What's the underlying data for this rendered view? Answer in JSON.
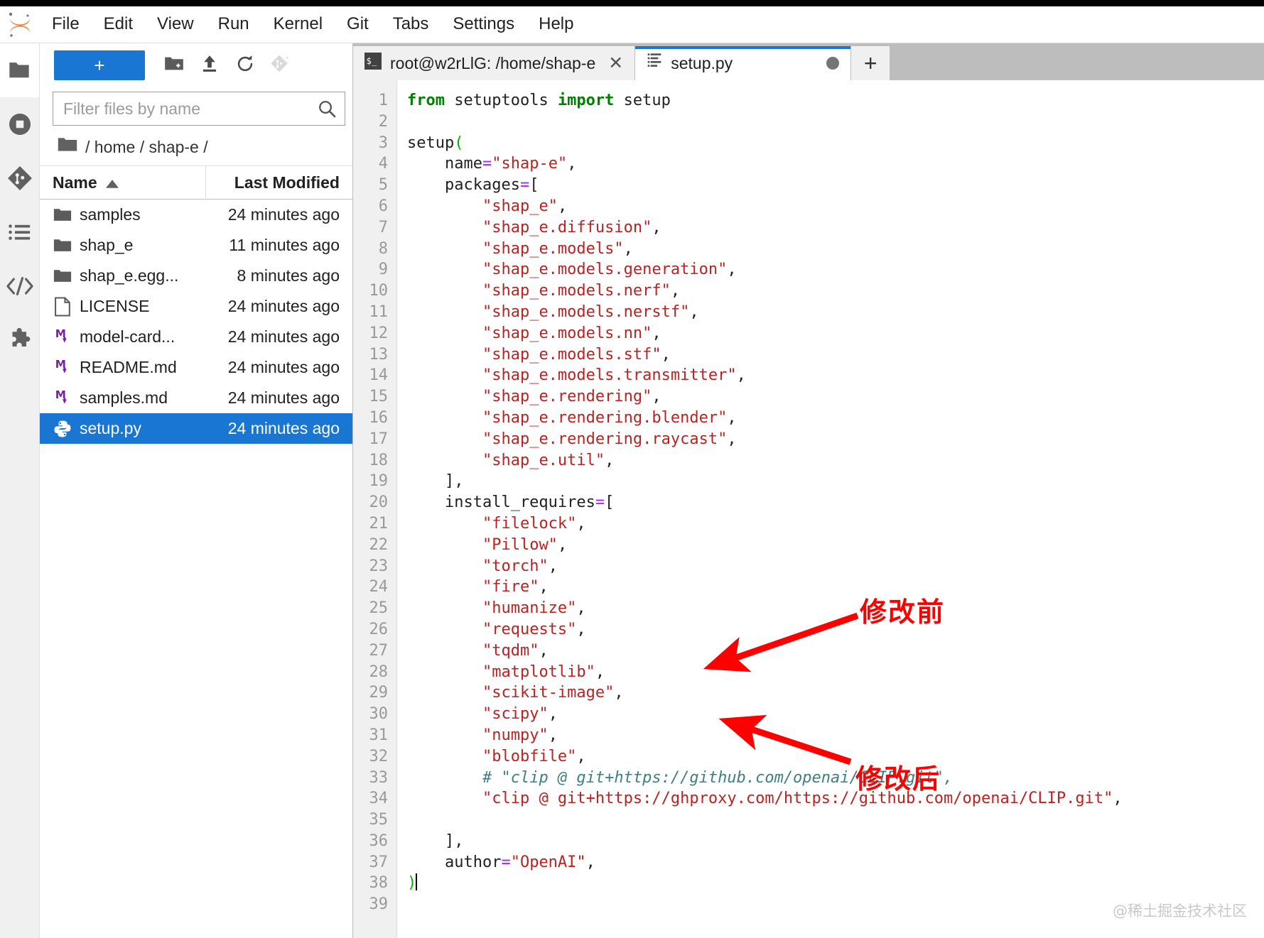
{
  "menubar": {
    "logo": "jupyter-logo",
    "items": [
      "File",
      "Edit",
      "View",
      "Run",
      "Kernel",
      "Git",
      "Tabs",
      "Settings",
      "Help"
    ]
  },
  "rail": {
    "items": [
      {
        "name": "file-browser",
        "icon": "folder-icon",
        "active": true
      },
      {
        "name": "running-terminals",
        "icon": "stop-circle-icon",
        "active": false
      },
      {
        "name": "git-panel",
        "icon": "git-icon",
        "active": false
      },
      {
        "name": "table-of-contents",
        "icon": "list-icon",
        "active": false
      },
      {
        "name": "code-snippets",
        "icon": "code-brackets-icon",
        "active": false
      },
      {
        "name": "extension-manager",
        "icon": "puzzle-piece-icon",
        "active": false
      }
    ]
  },
  "browser": {
    "toolbar": {
      "new_launcher_label": "+",
      "new_folder_icon": "new-folder-icon",
      "upload_icon": "upload-icon",
      "refresh_icon": "refresh-icon",
      "git_clone_icon": "git-clone-icon"
    },
    "filter": {
      "value": "",
      "placeholder": "Filter files by name",
      "search_icon": "search-icon"
    },
    "breadcrumb": "/ home / shap-e /",
    "columns": {
      "name": "Name",
      "last_modified": "Last Modified",
      "sort_indicator": "sort-ascending-icon"
    },
    "files": [
      {
        "name": "samples",
        "modified": "24 minutes ago",
        "icon": "folder-icon",
        "selected": false
      },
      {
        "name": "shap_e",
        "modified": "11 minutes ago",
        "icon": "folder-icon",
        "selected": false
      },
      {
        "name": "shap_e.egg...",
        "modified": "8 minutes ago",
        "icon": "folder-icon",
        "selected": false
      },
      {
        "name": "LICENSE",
        "modified": "24 minutes ago",
        "icon": "file-icon",
        "selected": false
      },
      {
        "name": "model-card...",
        "modified": "24 minutes ago",
        "icon": "markdown-icon",
        "selected": false
      },
      {
        "name": "README.md",
        "modified": "24 minutes ago",
        "icon": "markdown-icon",
        "selected": false
      },
      {
        "name": "samples.md",
        "modified": "24 minutes ago",
        "icon": "markdown-icon",
        "selected": false
      },
      {
        "name": "setup.py",
        "modified": "24 minutes ago",
        "icon": "python-icon",
        "selected": true
      }
    ]
  },
  "dock": {
    "tabs": [
      {
        "label": "root@w2rLlG: /home/shap-e",
        "icon": "terminal-icon",
        "active": false,
        "closable": true,
        "dirty": false
      },
      {
        "label": "setup.py",
        "icon": "text-file-icon",
        "active": true,
        "closable": false,
        "dirty": true
      }
    ],
    "add_tab_label": "+"
  },
  "editor": {
    "line_numbers": [
      1,
      2,
      3,
      4,
      5,
      6,
      7,
      8,
      9,
      10,
      11,
      12,
      13,
      14,
      15,
      16,
      17,
      18,
      19,
      20,
      21,
      22,
      23,
      24,
      25,
      26,
      27,
      28,
      29,
      30,
      31,
      32,
      33,
      34,
      35,
      36,
      37,
      38,
      39
    ],
    "lines": [
      [
        {
          "t": "from ",
          "c": "kw"
        },
        {
          "t": "setuptools ",
          "c": ""
        },
        {
          "t": "import ",
          "c": "kw"
        },
        {
          "t": "setup",
          "c": ""
        }
      ],
      [],
      [
        {
          "t": "setup",
          "c": ""
        },
        {
          "t": "(",
          "c": "paren"
        }
      ],
      [
        {
          "t": "    name",
          "c": ""
        },
        {
          "t": "=",
          "c": "op"
        },
        {
          "t": "\"shap-e\"",
          "c": "str"
        },
        {
          "t": ",",
          "c": ""
        }
      ],
      [
        {
          "t": "    packages",
          "c": ""
        },
        {
          "t": "=",
          "c": "op"
        },
        {
          "t": "[",
          "c": ""
        }
      ],
      [
        {
          "t": "        ",
          "c": ""
        },
        {
          "t": "\"shap_e\"",
          "c": "str"
        },
        {
          "t": ",",
          "c": ""
        }
      ],
      [
        {
          "t": "        ",
          "c": ""
        },
        {
          "t": "\"shap_e.diffusion\"",
          "c": "str"
        },
        {
          "t": ",",
          "c": ""
        }
      ],
      [
        {
          "t": "        ",
          "c": ""
        },
        {
          "t": "\"shap_e.models\"",
          "c": "str"
        },
        {
          "t": ",",
          "c": ""
        }
      ],
      [
        {
          "t": "        ",
          "c": ""
        },
        {
          "t": "\"shap_e.models.generation\"",
          "c": "str"
        },
        {
          "t": ",",
          "c": ""
        }
      ],
      [
        {
          "t": "        ",
          "c": ""
        },
        {
          "t": "\"shap_e.models.nerf\"",
          "c": "str"
        },
        {
          "t": ",",
          "c": ""
        }
      ],
      [
        {
          "t": "        ",
          "c": ""
        },
        {
          "t": "\"shap_e.models.nerstf\"",
          "c": "str"
        },
        {
          "t": ",",
          "c": ""
        }
      ],
      [
        {
          "t": "        ",
          "c": ""
        },
        {
          "t": "\"shap_e.models.nn\"",
          "c": "str"
        },
        {
          "t": ",",
          "c": ""
        }
      ],
      [
        {
          "t": "        ",
          "c": ""
        },
        {
          "t": "\"shap_e.models.stf\"",
          "c": "str"
        },
        {
          "t": ",",
          "c": ""
        }
      ],
      [
        {
          "t": "        ",
          "c": ""
        },
        {
          "t": "\"shap_e.models.transmitter\"",
          "c": "str"
        },
        {
          "t": ",",
          "c": ""
        }
      ],
      [
        {
          "t": "        ",
          "c": ""
        },
        {
          "t": "\"shap_e.rendering\"",
          "c": "str"
        },
        {
          "t": ",",
          "c": ""
        }
      ],
      [
        {
          "t": "        ",
          "c": ""
        },
        {
          "t": "\"shap_e.rendering.blender\"",
          "c": "str"
        },
        {
          "t": ",",
          "c": ""
        }
      ],
      [
        {
          "t": "        ",
          "c": ""
        },
        {
          "t": "\"shap_e.rendering.raycast\"",
          "c": "str"
        },
        {
          "t": ",",
          "c": ""
        }
      ],
      [
        {
          "t": "        ",
          "c": ""
        },
        {
          "t": "\"shap_e.util\"",
          "c": "str"
        },
        {
          "t": ",",
          "c": ""
        }
      ],
      [
        {
          "t": "    ],",
          "c": ""
        }
      ],
      [
        {
          "t": "    install_requires",
          "c": ""
        },
        {
          "t": "=",
          "c": "op"
        },
        {
          "t": "[",
          "c": ""
        }
      ],
      [
        {
          "t": "        ",
          "c": ""
        },
        {
          "t": "\"filelock\"",
          "c": "str"
        },
        {
          "t": ",",
          "c": ""
        }
      ],
      [
        {
          "t": "        ",
          "c": ""
        },
        {
          "t": "\"Pillow\"",
          "c": "str"
        },
        {
          "t": ",",
          "c": ""
        }
      ],
      [
        {
          "t": "        ",
          "c": ""
        },
        {
          "t": "\"torch\"",
          "c": "str"
        },
        {
          "t": ",",
          "c": ""
        }
      ],
      [
        {
          "t": "        ",
          "c": ""
        },
        {
          "t": "\"fire\"",
          "c": "str"
        },
        {
          "t": ",",
          "c": ""
        }
      ],
      [
        {
          "t": "        ",
          "c": ""
        },
        {
          "t": "\"humanize\"",
          "c": "str"
        },
        {
          "t": ",",
          "c": ""
        }
      ],
      [
        {
          "t": "        ",
          "c": ""
        },
        {
          "t": "\"requests\"",
          "c": "str"
        },
        {
          "t": ",",
          "c": ""
        }
      ],
      [
        {
          "t": "        ",
          "c": ""
        },
        {
          "t": "\"tqdm\"",
          "c": "str"
        },
        {
          "t": ",",
          "c": ""
        }
      ],
      [
        {
          "t": "        ",
          "c": ""
        },
        {
          "t": "\"matplotlib\"",
          "c": "str"
        },
        {
          "t": ",",
          "c": ""
        }
      ],
      [
        {
          "t": "        ",
          "c": ""
        },
        {
          "t": "\"scikit-image\"",
          "c": "str"
        },
        {
          "t": ",",
          "c": ""
        }
      ],
      [
        {
          "t": "        ",
          "c": ""
        },
        {
          "t": "\"scipy\"",
          "c": "str"
        },
        {
          "t": ",",
          "c": ""
        }
      ],
      [
        {
          "t": "        ",
          "c": ""
        },
        {
          "t": "\"numpy\"",
          "c": "str"
        },
        {
          "t": ",",
          "c": ""
        }
      ],
      [
        {
          "t": "        ",
          "c": ""
        },
        {
          "t": "\"blobfile\"",
          "c": "str"
        },
        {
          "t": ",",
          "c": ""
        }
      ],
      [
        {
          "t": "        ",
          "c": ""
        },
        {
          "t": "# \"clip @ git+https://github.com/openai/CLIP.git\",",
          "c": "com"
        }
      ],
      [
        {
          "t": "        ",
          "c": ""
        },
        {
          "t": "\"clip @ git+https://ghproxy.com/https://github.com/openai/CLIP.git\"",
          "c": "str"
        },
        {
          "t": ",",
          "c": ""
        }
      ],
      [],
      [
        {
          "t": "    ],",
          "c": ""
        }
      ],
      [
        {
          "t": "    author",
          "c": ""
        },
        {
          "t": "=",
          "c": "op"
        },
        {
          "t": "\"OpenAI\"",
          "c": "str"
        },
        {
          "t": ",",
          "c": ""
        }
      ],
      [
        {
          "t": ")",
          "c": "paren"
        },
        {
          "t": "|CURSOR|",
          "c": "cursor"
        }
      ],
      []
    ]
  },
  "annotations": {
    "before_label": "修改前",
    "after_label": "修改后",
    "arrow_color": "#ff0000"
  },
  "watermark": "@稀土掘金技术社区",
  "colors": {
    "accent": "#1976d2",
    "selection": "#1976d2",
    "annotation": "#ff0000",
    "string": "#bb2222",
    "keyword": "#008000",
    "comment": "#408080",
    "operator": "#aa22ff"
  }
}
